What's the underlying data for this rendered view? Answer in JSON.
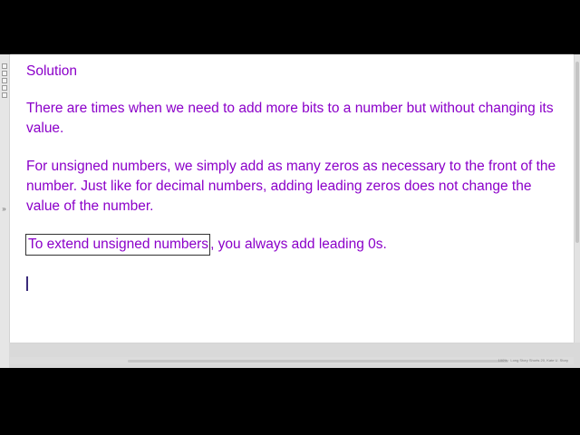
{
  "document": {
    "heading": "Solution",
    "paragraphs": [
      "There are times when we need to add more bits to a number but without changing its value.",
      "For unsigned numbers, we simply add as many zeros as necessary to the front of the number. Just like for decimal numbers, adding leading zeros does not change the value of the number."
    ],
    "highlight_sentence": {
      "boxed_text": "To extend unsigned numbers",
      "rest_text": ", you always add leading 0s."
    },
    "text_color": "#8b00c9"
  },
  "sidebar": {
    "tools": [
      "page-icon",
      "pen-icon",
      "shape-icon",
      "highlighter-icon",
      "checkbox-icon"
    ],
    "collapse_icon": "double-chevron-right-icon"
  },
  "status_bar": {
    "text": "100% · Long Story Shorts 20, Kate U. Story"
  }
}
